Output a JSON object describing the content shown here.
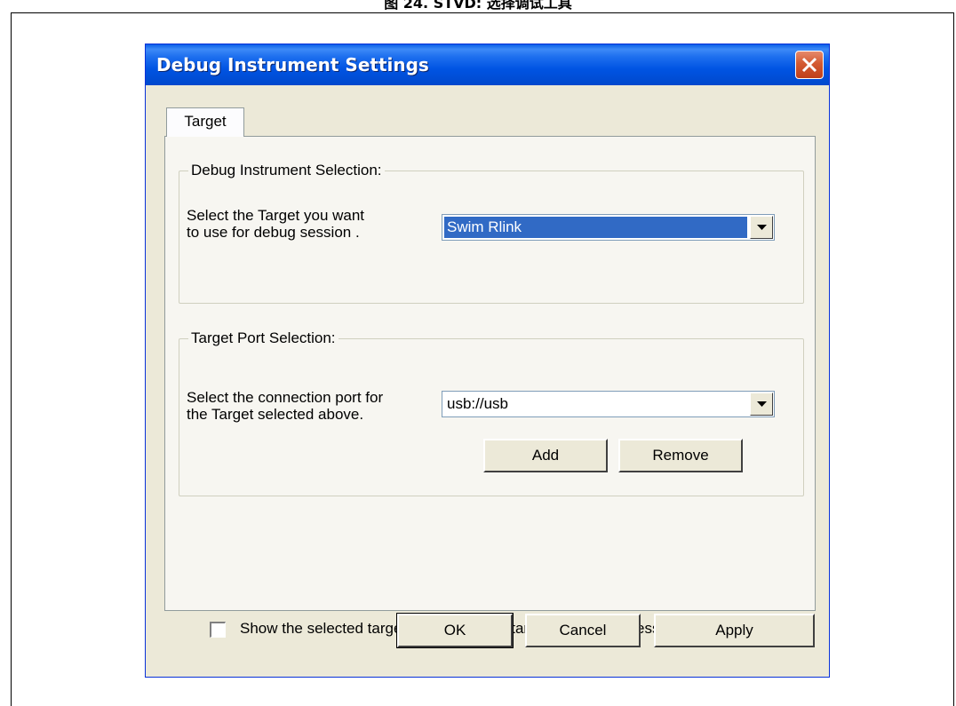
{
  "caption": "图 24. STVD: 选择调试工具",
  "window": {
    "title": "Debug Instrument Settings"
  },
  "tabs": [
    {
      "label": "Target"
    }
  ],
  "instrument_group": {
    "legend": "Debug Instrument Selection:",
    "label_line1": "Select the Target you want",
    "label_line2": "to use for debug session .",
    "selected_value": "Swim Rlink"
  },
  "port_group": {
    "legend": "Target Port Selection:",
    "label_line1": "Select the connection port for",
    "label_line2": "the Target selected above.",
    "selected_value": "usb://usb",
    "add_label": "Add",
    "remove_label": "Remove"
  },
  "notification_checkbox": {
    "label": "Show the selected target notification at start of debugging session",
    "checked": false
  },
  "footer": {
    "ok_label": "OK",
    "cancel_label": "Cancel",
    "apply_label": "Apply"
  },
  "colors": {
    "titlebar": "#0054e3",
    "window_bg": "#ece9d8",
    "selection": "#316ac5",
    "close_button": "#d35a32"
  }
}
